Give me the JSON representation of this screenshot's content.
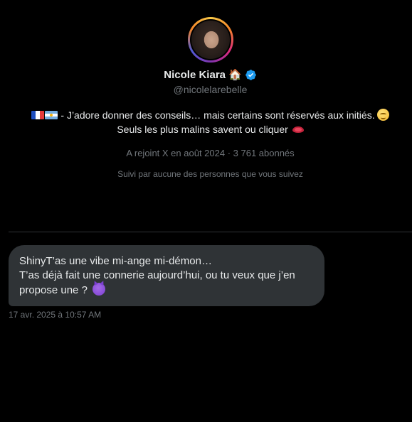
{
  "profile": {
    "name": "Nicole Kiara",
    "name_emoji": "🏠",
    "handle": "@nicolelarebelle",
    "verified": true,
    "bio_line1": " - J’adore donner des conseils… mais certains sont réservés aux initiés. ",
    "bio_line2": "Seuls les plus malins savent ou cliquer ",
    "joined_text": "A rejoint X en août 2024 · 3 761 abonnés",
    "followed_by_text": "Suivi par aucune des personnes que vous suivez"
  },
  "message": {
    "line1": "ShinyT’as une vibe mi-ange mi-démon…",
    "line2": "T’as déjà fait une connerie aujourd’hui, ou tu veux que j’en",
    "line3": "propose une ? ",
    "timestamp": "17 avr. 2025 à 10:57 AM"
  },
  "icons": {
    "avatar": "profile-photo",
    "badge": "verified-check-icon",
    "flags": [
      "flag-france-icon",
      "flag-argentina-icon"
    ],
    "bio_emojis": [
      "smirk-face-icon",
      "lips-icon"
    ],
    "message_emoji": "smiling-devil-icon"
  },
  "colors": {
    "background": "#000000",
    "text_primary": "#e7e9ea",
    "text_secondary": "#71767b",
    "bubble": "#2f3336",
    "verified": "#1d9bf0"
  }
}
